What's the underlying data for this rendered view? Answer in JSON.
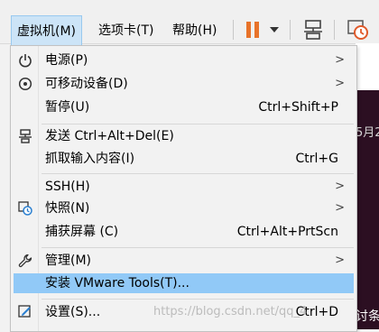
{
  "menubar": {
    "items": [
      "虚拟机(M)",
      "选项卡(T)",
      "帮助(H)"
    ]
  },
  "toolbar": {
    "pause_icon": "pause-icon",
    "dropdown_icon": "chevron-down-icon",
    "network_icon": "network-icon",
    "snapshot_icon": "snapshot-clock-icon",
    "pause_color": "#e8732a"
  },
  "background": {
    "date_fragment": "5月2",
    "footer_fragment": "讨条"
  },
  "vm_menu": {
    "items": [
      {
        "label": "电源(P)",
        "icon": "power-icon",
        "submenu": true
      },
      {
        "label": "可移动设备(D)",
        "icon": "removable-devices-icon",
        "submenu": true
      },
      {
        "label": "暂停(U)",
        "shortcut": "Ctrl+Shift+P"
      },
      {
        "label": "发送 Ctrl+Alt+Del(E)",
        "icon": "send-keys-icon"
      },
      {
        "label": "抓取输入内容(I)",
        "shortcut": "Ctrl+G"
      },
      {
        "label": "SSH(H)",
        "submenu": true
      },
      {
        "label": "快照(N)",
        "icon": "snapshot-icon",
        "submenu": true
      },
      {
        "label": "捕获屏幕 (C)",
        "shortcut": "Ctrl+Alt+PrtScn"
      },
      {
        "label": "管理(M)",
        "icon": "wrench-icon",
        "submenu": true
      },
      {
        "label": "安装 VMware Tools(T)..."
      },
      {
        "label": "设置(S)...",
        "icon": "settings-icon",
        "shortcut": "Ctrl+D"
      }
    ],
    "highlighted_item": "安装 VMware Tools(T)...",
    "highlight_color": "#91c9f7",
    "submenu_arrow": ">"
  },
  "watermark": "https://blog.csdn.net/qq_4"
}
